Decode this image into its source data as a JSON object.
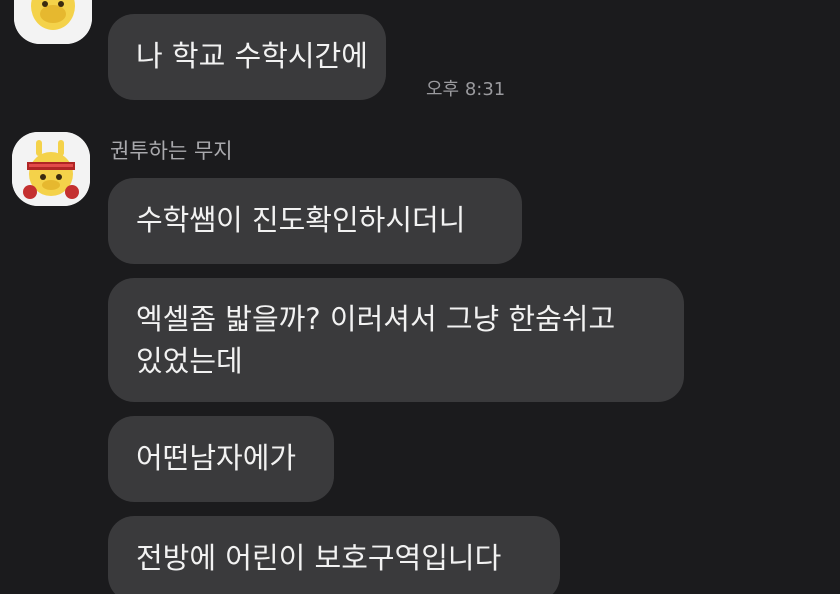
{
  "messages_top": {
    "bubble_1": "나 학교 수학시간에",
    "time": "오후 8:31"
  },
  "sender": {
    "name": "권투하는 무지",
    "avatar_icon": "muzi-boxer-avatar-icon"
  },
  "messages": [
    {
      "text": "수학쌤이 진도확인하시더니"
    },
    {
      "line1": "엑셀좀 밟을까? 이러셔서 그냥 한숨쉬고",
      "line2": "있었는데"
    },
    {
      "text": "어떤남자에가"
    },
    {
      "text": "전방에 어린이 보호구역입니다"
    }
  ],
  "colors": {
    "background": "#1b1b1d",
    "bubble": "#3a3a3c",
    "text": "#f2f2f2"
  }
}
